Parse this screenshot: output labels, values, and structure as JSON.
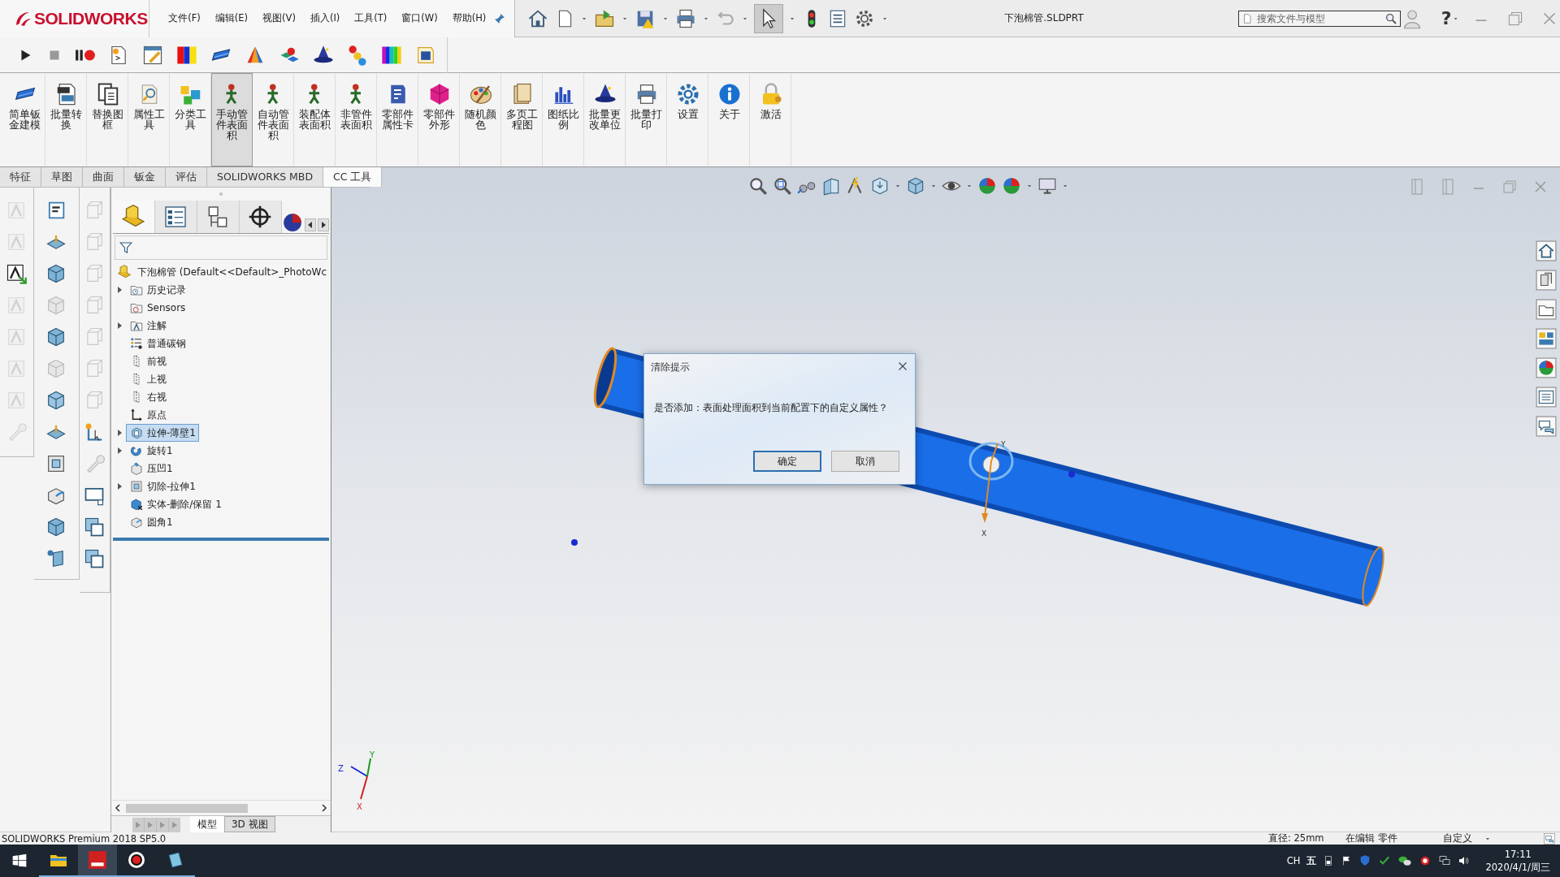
{
  "title_bar": {
    "logo": "SOLIDWORKS",
    "menus": [
      "文件(F)",
      "编辑(E)",
      "视图(V)",
      "插入(I)",
      "工具(T)",
      "窗口(W)",
      "帮助(H)"
    ],
    "document_title": "下泡棉管.SLDPRT",
    "search": {
      "placeholder": "搜索文件与模型"
    },
    "help": "?"
  },
  "ribbon": [
    {
      "label": "简单钣金建模",
      "selected": false
    },
    {
      "label": "批量转换",
      "selected": false
    },
    {
      "label": "替换图框",
      "selected": false
    },
    {
      "label": "属性工具",
      "selected": false
    },
    {
      "label": "分类工具",
      "selected": false
    },
    {
      "label": "手动管件表面积",
      "selected": true
    },
    {
      "label": "自动管件表面积",
      "selected": false
    },
    {
      "label": "装配体表面积",
      "selected": false
    },
    {
      "label": "非管件表面积",
      "selected": false
    },
    {
      "label": "零部件属性卡",
      "selected": false
    },
    {
      "label": "零部件外形",
      "selected": false
    },
    {
      "label": "随机颜色",
      "selected": false
    },
    {
      "label": "多页工程图",
      "selected": false
    },
    {
      "label": "图纸比例",
      "selected": false
    },
    {
      "label": "批量更改单位",
      "selected": false
    },
    {
      "label": "批量打印",
      "selected": false
    },
    {
      "label": "设置",
      "selected": false
    },
    {
      "label": "关于",
      "selected": false
    },
    {
      "label": "激活",
      "selected": false
    }
  ],
  "command_tabs": [
    {
      "label": "特征",
      "selected": false
    },
    {
      "label": "草图",
      "selected": false
    },
    {
      "label": "曲面",
      "selected": false
    },
    {
      "label": "钣金",
      "selected": false
    },
    {
      "label": "评估",
      "selected": false
    },
    {
      "label": "SOLIDWORKS MBD",
      "selected": false
    },
    {
      "label": "CC 工具",
      "selected": true
    }
  ],
  "feature_tree": {
    "root": "下泡棉管  (Default<<Default>_PhotoWc",
    "items": [
      {
        "label": "历史记录",
        "kind": "history",
        "expandable": true,
        "selected": false
      },
      {
        "label": "Sensors",
        "kind": "sensors",
        "expandable": false,
        "selected": false
      },
      {
        "label": "注解",
        "kind": "annotation",
        "expandable": true,
        "selected": false
      },
      {
        "label": "普通碳钢",
        "kind": "material",
        "expandable": false,
        "selected": false
      },
      {
        "label": "前视",
        "kind": "plane",
        "expandable": false,
        "selected": false
      },
      {
        "label": "上视",
        "kind": "plane",
        "expandable": false,
        "selected": false
      },
      {
        "label": "右视",
        "kind": "plane",
        "expandable": false,
        "selected": false
      },
      {
        "label": "原点",
        "kind": "origin",
        "expandable": false,
        "selected": false
      },
      {
        "label": "拉伸-薄壁1",
        "kind": "extrude",
        "expandable": true,
        "selected": true
      },
      {
        "label": "旋转1",
        "kind": "revolve",
        "expandable": true,
        "selected": false
      },
      {
        "label": "压凹1",
        "kind": "indent",
        "expandable": false,
        "selected": false
      },
      {
        "label": "切除-拉伸1",
        "kind": "cut",
        "expandable": true,
        "selected": false
      },
      {
        "label": "实体-删除/保留 1",
        "kind": "delete",
        "expandable": false,
        "selected": false
      },
      {
        "label": "圆角1",
        "kind": "fillet",
        "expandable": false,
        "selected": false
      }
    ],
    "tabs": [
      {
        "label": "模型",
        "selected": true
      },
      {
        "label": "3D 视图",
        "selected": false
      }
    ]
  },
  "viewport": {
    "axis_labels": [
      "Z",
      "Y",
      "X"
    ],
    "part_triad_labels": [
      "Y",
      "X"
    ]
  },
  "dialog": {
    "title": "清除提示",
    "message": "是否添加：表面处理面积到当前配置下的自定义属性？",
    "buttons": [
      {
        "label": "确定",
        "focused": true
      },
      {
        "label": "取消",
        "focused": false
      }
    ]
  },
  "status_bar": {
    "product": "SOLIDWORKS Premium 2018 SP5.0",
    "measure": "直径: 25mm",
    "mode": "在编辑 零件",
    "units": "自定义"
  },
  "taskbar": {
    "input_language": "CH",
    "input_method": "五",
    "time": "17:11",
    "date": "2020/4/1/周三"
  }
}
